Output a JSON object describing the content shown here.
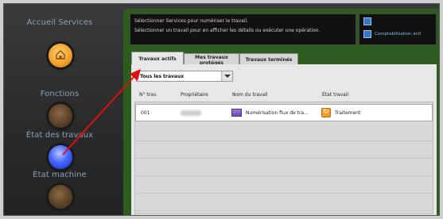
{
  "left_panel": {
    "services_label": "Accueil Services",
    "fonctions_label": "Fonctions",
    "etat_travaux_label": "État des travaux",
    "etat_machine_label": "État machine"
  },
  "message": {
    "line1": "Sélectionner Services pour numériser le travail.",
    "line2": "Sélectionner un travail pour en afficher les détails ou exécuter une opération."
  },
  "status": {
    "item2": "Comptabilisation acti"
  },
  "tabs": [
    {
      "label": "Travaux actifs"
    },
    {
      "label": "Mes travaux protégés"
    },
    {
      "label": "Travaux terminés"
    }
  ],
  "filter": {
    "value": "Tous les travaux"
  },
  "columns": {
    "no": "N° trav.",
    "owner": "Propriétaire",
    "name": "Nom du travail",
    "state": "État travail"
  },
  "rows": [
    {
      "no": "001",
      "name": "Numérisation flux de tra...",
      "state": "Traitement"
    }
  ],
  "colors": {
    "screen_green": "#2d5d1e",
    "arrow_red": "#e01010",
    "active_button_blue": "#4466ff"
  }
}
